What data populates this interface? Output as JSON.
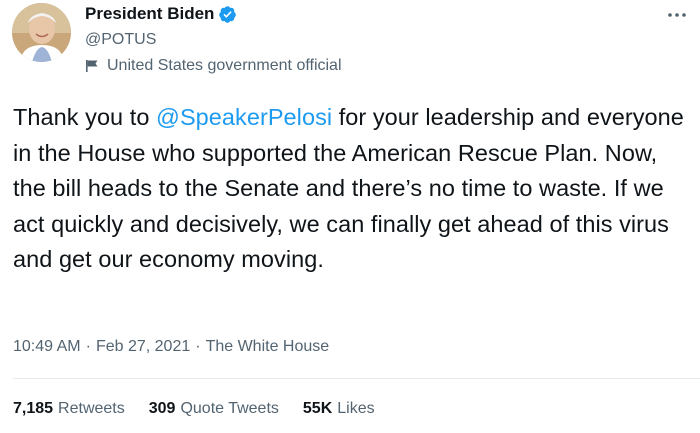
{
  "colors": {
    "accent": "#1d9bf0",
    "text_primary": "#0f1419",
    "text_secondary": "#536471"
  },
  "author": {
    "display_name": "President Biden",
    "handle": "@POTUS",
    "label": "United States government official",
    "verified_icon": "verified-badge-icon",
    "label_icon": "flag-icon"
  },
  "tweet": {
    "text_before": "Thank you to ",
    "mention": "@SpeakerPelosi",
    "text_after": " for your leadership and everyone in the House who supported the American Rescue Plan. Now, the bill heads to the Senate and there’s no time to waste. If we act quickly and decisively, we can finally get ahead of this virus and get our economy moving."
  },
  "meta": {
    "time": "10:49 AM",
    "separator": "·",
    "date": "Feb 27, 2021",
    "source": "The White House"
  },
  "stats": [
    {
      "value": "7,185",
      "label": "Retweets"
    },
    {
      "value": "309",
      "label": "Quote Tweets"
    },
    {
      "value": "55K",
      "label": "Likes"
    }
  ],
  "more_icon": "more-options-icon"
}
